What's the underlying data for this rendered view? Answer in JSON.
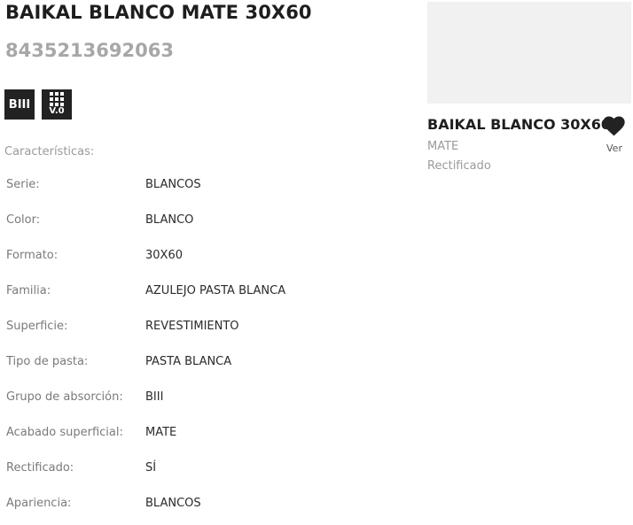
{
  "product": {
    "title": "BAIKAL BLANCO MATE 30X60",
    "ean": "8435213692063"
  },
  "badges": {
    "absorption": "BIII",
    "version": "V.0",
    "version_icon": "grid-icon"
  },
  "characteristics_label": "Características:",
  "specs": [
    {
      "label": "Serie:",
      "value": "BLANCOS"
    },
    {
      "label": "Color:",
      "value": "BLANCO"
    },
    {
      "label": "Formato:",
      "value": "30X60"
    },
    {
      "label": "Familia:",
      "value": "AZULEJO PASTA BLANCA"
    },
    {
      "label": "Superficie:",
      "value": "REVESTIMIENTO"
    },
    {
      "label": "Tipo de pasta:",
      "value": "PASTA BLANCA"
    },
    {
      "label": "Grupo de absorción:",
      "value": "BIII"
    },
    {
      "label": "Acabado superficial:",
      "value": "MATE"
    },
    {
      "label": "Rectificado:",
      "value": "SÍ"
    },
    {
      "label": "Apariencia:",
      "value": "BLANCOS"
    }
  ],
  "related": {
    "title": "BAIKAL BLANCO 30X60",
    "finish": "MATE",
    "edge": "Rectificado",
    "view_label": "Ver",
    "favorite_icon": "heart-icon"
  },
  "colors": {
    "text": "#1e1e1e",
    "muted": "#9a9a9a",
    "ean": "#a7a7a7",
    "badge_bg": "#222222",
    "thumb_bg": "#f1f1f1"
  }
}
